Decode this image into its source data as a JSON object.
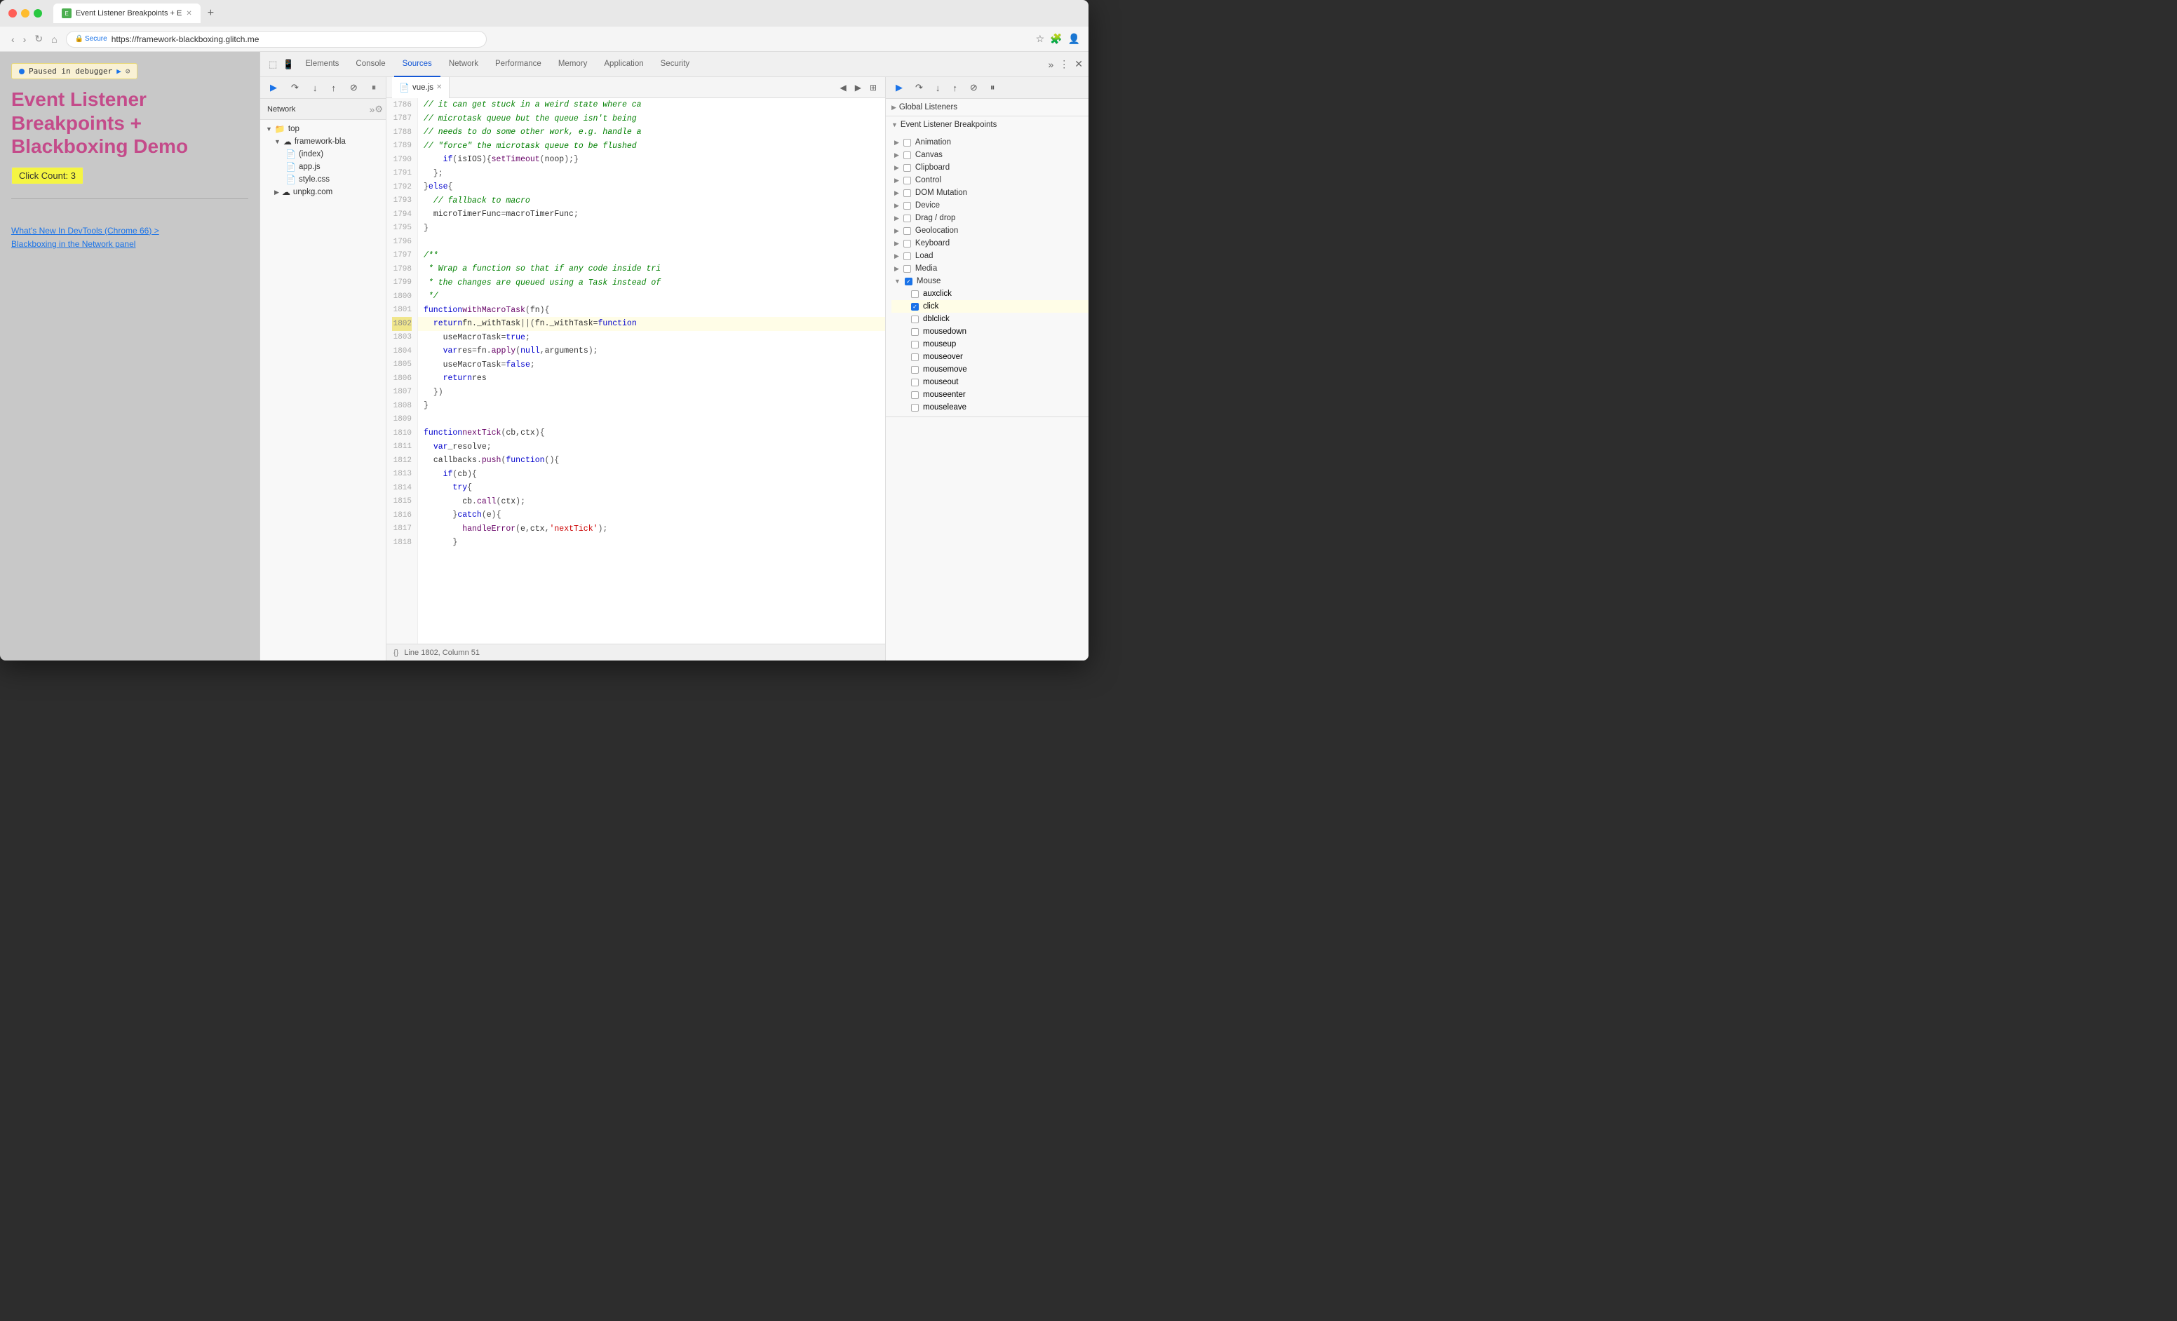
{
  "browser": {
    "tab_title": "Event Listener Breakpoints + E",
    "url_secure": "Secure",
    "url": "https://framework-blackboxing.glitch.me",
    "new_tab_symbol": "+"
  },
  "page": {
    "paused_label": "Paused in debugger",
    "title_line1": "Event Listener",
    "title_line2": "Breakpoints +",
    "title_line3": "Blackboxing Demo",
    "click_count": "Click Count: 3",
    "link1": "What's New In DevTools (Chrome 66) >",
    "link2": "Blackboxing in the Network panel"
  },
  "devtools": {
    "tabs": [
      "Elements",
      "Console",
      "Sources",
      "Network",
      "Performance",
      "Memory",
      "Application",
      "Security"
    ],
    "active_tab": "Sources"
  },
  "sources_left": {
    "tabs": [
      "Network"
    ],
    "file_tree": [
      {
        "label": "top",
        "type": "folder",
        "indent": 0,
        "expanded": true
      },
      {
        "label": "framework-bla",
        "type": "cloud",
        "indent": 1,
        "expanded": true
      },
      {
        "label": "(index)",
        "type": "html",
        "indent": 2
      },
      {
        "label": "app.js",
        "type": "js",
        "indent": 2
      },
      {
        "label": "style.css",
        "type": "css",
        "indent": 2
      },
      {
        "label": "unpkg.com",
        "type": "cloud",
        "indent": 1,
        "expanded": false
      }
    ]
  },
  "editor": {
    "filename": "vue.js",
    "lines": [
      {
        "num": 1786,
        "content": "// it can get stuck in a weird state where ca",
        "type": "comment"
      },
      {
        "num": 1787,
        "content": "// microtask queue but the queue isn't being",
        "type": "comment"
      },
      {
        "num": 1788,
        "content": "// needs to do some other work, e.g. handle a",
        "type": "comment"
      },
      {
        "num": 1789,
        "content": "// \"force\" the microtask queue to be flushed",
        "type": "comment"
      },
      {
        "num": 1790,
        "content": "if (isIOS) { setTimeout(noop); }",
        "type": "code"
      },
      {
        "num": 1791,
        "content": "};",
        "type": "code"
      },
      {
        "num": 1792,
        "content": "} else {",
        "type": "code"
      },
      {
        "num": 1793,
        "content": "// fallback to macro",
        "type": "comment"
      },
      {
        "num": 1794,
        "content": "microTimerFunc = macroTimerFunc;",
        "type": "code"
      },
      {
        "num": 1795,
        "content": "}",
        "type": "code"
      },
      {
        "num": 1796,
        "content": "",
        "type": "empty"
      },
      {
        "num": 1797,
        "content": "/**",
        "type": "comment"
      },
      {
        "num": 1798,
        "content": "* Wrap a function so that if any code inside tri",
        "type": "comment"
      },
      {
        "num": 1799,
        "content": "* the changes are queued using a Task instead of",
        "type": "comment"
      },
      {
        "num": 1800,
        "content": "*/",
        "type": "comment"
      },
      {
        "num": 1801,
        "content": "function withMacroTask (fn) {",
        "type": "code"
      },
      {
        "num": 1802,
        "content": "return fn._withTask || (fn._withTask = function",
        "type": "code",
        "highlighted": true
      },
      {
        "num": 1803,
        "content": "useMacroTask = true;",
        "type": "code"
      },
      {
        "num": 1804,
        "content": "var res = fn.apply(null, arguments);",
        "type": "code"
      },
      {
        "num": 1805,
        "content": "useMacroTask = false;",
        "type": "code"
      },
      {
        "num": 1806,
        "content": "return res",
        "type": "code"
      },
      {
        "num": 1807,
        "content": "})",
        "type": "code"
      },
      {
        "num": 1808,
        "content": "}",
        "type": "code"
      },
      {
        "num": 1809,
        "content": "",
        "type": "empty"
      },
      {
        "num": 1810,
        "content": "function nextTick (cb, ctx) {",
        "type": "code"
      },
      {
        "num": 1811,
        "content": "var _resolve;",
        "type": "code"
      },
      {
        "num": 1812,
        "content": "callbacks.push(function () {",
        "type": "code"
      },
      {
        "num": 1813,
        "content": "if (cb) {",
        "type": "code"
      },
      {
        "num": 1814,
        "content": "try {",
        "type": "code"
      },
      {
        "num": 1815,
        "content": "cb.call(ctx);",
        "type": "code"
      },
      {
        "num": 1816,
        "content": "} catch (e) {",
        "type": "code"
      },
      {
        "num": 1817,
        "content": "handleError(e, ctx, 'nextTick');",
        "type": "code"
      },
      {
        "num": 1818,
        "content": "}",
        "type": "code"
      }
    ],
    "footer": "Line 1802, Column 51"
  },
  "right_panel": {
    "global_listeners_label": "Global Listeners",
    "breakpoints_label": "Event Listener Breakpoints",
    "categories": [
      {
        "label": "Animation",
        "checked": false,
        "expanded": false
      },
      {
        "label": "Canvas",
        "checked": false,
        "expanded": false
      },
      {
        "label": "Clipboard",
        "checked": false,
        "expanded": false
      },
      {
        "label": "Control",
        "checked": false,
        "expanded": false
      },
      {
        "label": "DOM Mutation",
        "checked": false,
        "expanded": false
      },
      {
        "label": "Device",
        "checked": false,
        "expanded": false
      },
      {
        "label": "Drag / drop",
        "checked": false,
        "expanded": false
      },
      {
        "label": "Geolocation",
        "checked": false,
        "expanded": false
      },
      {
        "label": "Keyboard",
        "checked": false,
        "expanded": false
      },
      {
        "label": "Load",
        "checked": false,
        "expanded": false
      },
      {
        "label": "Media",
        "checked": false,
        "expanded": false
      },
      {
        "label": "Mouse",
        "checked": false,
        "expanded": true
      }
    ],
    "mouse_children": [
      {
        "label": "auxclick",
        "checked": false
      },
      {
        "label": "click",
        "checked": true
      },
      {
        "label": "dblclick",
        "checked": false
      },
      {
        "label": "mousedown",
        "checked": false
      },
      {
        "label": "mouseup",
        "checked": false
      },
      {
        "label": "mouseover",
        "checked": false
      },
      {
        "label": "mousemove",
        "checked": false
      },
      {
        "label": "mouseout",
        "checked": false
      },
      {
        "label": "mouseenter",
        "checked": false
      },
      {
        "label": "mouseleave",
        "checked": false
      }
    ]
  },
  "debug_toolbar": {
    "resume_label": "▶",
    "step_over_label": "↷",
    "step_into_label": "↓",
    "step_out_label": "↑",
    "deactivate_label": "⊘",
    "pause_label": "⏸"
  }
}
